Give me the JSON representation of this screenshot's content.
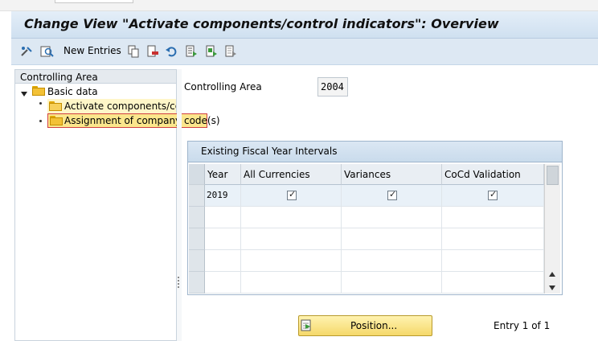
{
  "window": {
    "title": "Change View \"Activate components/control indicators\": Overview"
  },
  "toolbar": {
    "new_entries_label": "New Entries",
    "icons": [
      "display-change-icon",
      "details-icon",
      "copy-icon",
      "delete-icon",
      "undo-icon",
      "select-all-icon",
      "select-block-icon",
      "deselect-all-icon"
    ]
  },
  "tree": {
    "header": "Controlling Area",
    "root": "Basic data",
    "children": [
      {
        "label": "Activate components/cor"
      },
      {
        "label": "Assignment of company code(s)"
      }
    ]
  },
  "form": {
    "controlling_area_label": "Controlling Area",
    "controlling_area_value": "2004"
  },
  "fiscal_table": {
    "group_title": "Existing Fiscal Year Intervals",
    "columns": [
      "Year",
      "All Currencies",
      "Variances",
      "CoCd Validation"
    ],
    "rows": [
      {
        "year": "2019",
        "all_currencies": true,
        "variances": true,
        "cocd_validation": true
      }
    ]
  },
  "footer": {
    "position_button": "Position...",
    "entry_text": "Entry 1 of 1"
  },
  "colors": {
    "title_bg": "#cfe0f0",
    "toolbar_bg": "#dde8f3",
    "folder": "#f3c136",
    "selected_node_border": "#d04040",
    "button_yellow": "#f5d86a"
  }
}
